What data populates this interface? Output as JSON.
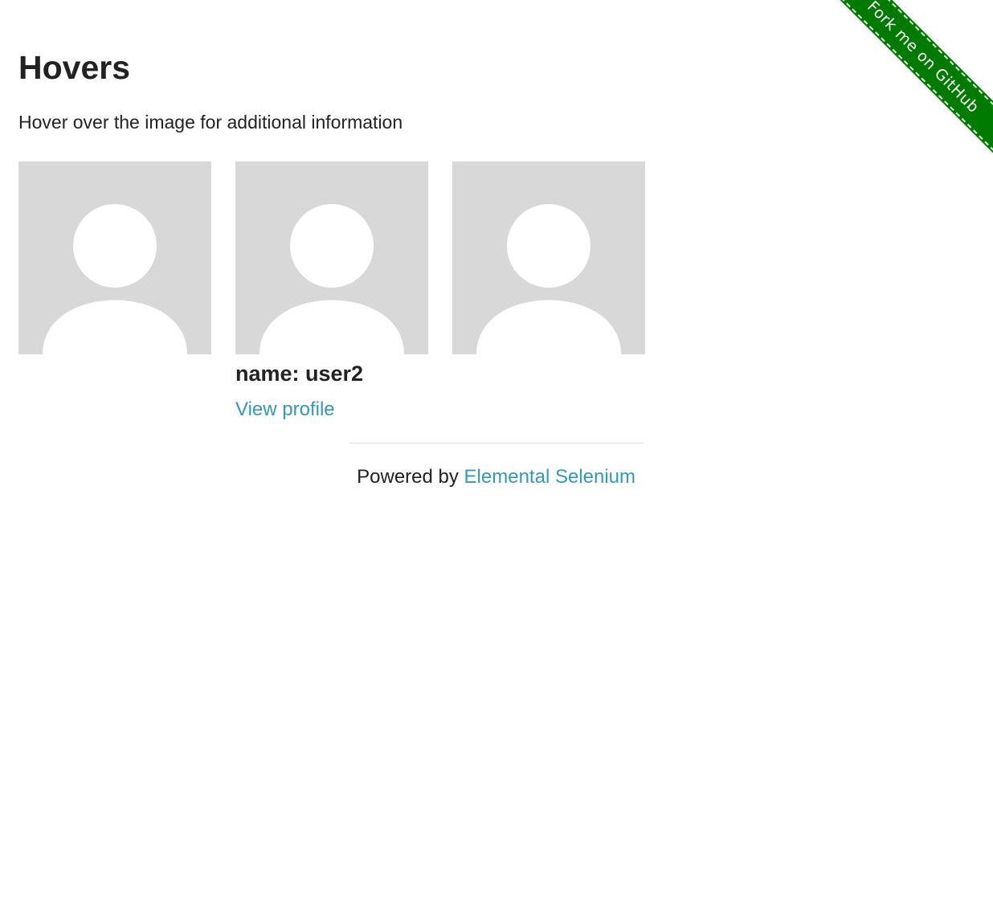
{
  "ribbon": {
    "label": "Fork me on GitHub",
    "color": "#007a00"
  },
  "page": {
    "title": "Hovers",
    "intro": "Hover over the image for additional information"
  },
  "figures": [
    {
      "avatar_icon": "user-placeholder-icon"
    },
    {
      "avatar_icon": "user-placeholder-icon",
      "caption_name": "name: user2",
      "caption_link": "View profile"
    },
    {
      "avatar_icon": "user-placeholder-icon"
    }
  ],
  "footer": {
    "prefix": "Powered by ",
    "link_label": "Elemental Selenium",
    "link_color": "#3399bb"
  },
  "colors": {
    "avatar_bg": "#d8d8d8",
    "avatar_fg": "#ffffff"
  }
}
